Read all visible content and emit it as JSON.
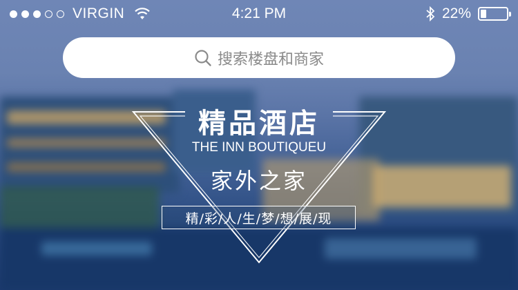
{
  "status_bar": {
    "signal_filled": 3,
    "signal_total": 5,
    "carrier": "VIRGIN",
    "wifi_icon": "wifi-icon",
    "time": "4:21 PM",
    "bluetooth_icon": "bluetooth-icon",
    "battery_percent": "22%",
    "battery_level": 0.22
  },
  "search": {
    "placeholder": "搜索楼盘和商家",
    "icon": "search-icon"
  },
  "banner": {
    "title": "精品酒店",
    "subtitle": "THE INN BOUTIQUEU",
    "slogan": "家外之家",
    "tagline": "精/彩/人/生/梦/想/展/现"
  },
  "colors": {
    "search_bg": "#ffffff",
    "text_light": "#ffffff",
    "placeholder": "#8a8a8a"
  }
}
